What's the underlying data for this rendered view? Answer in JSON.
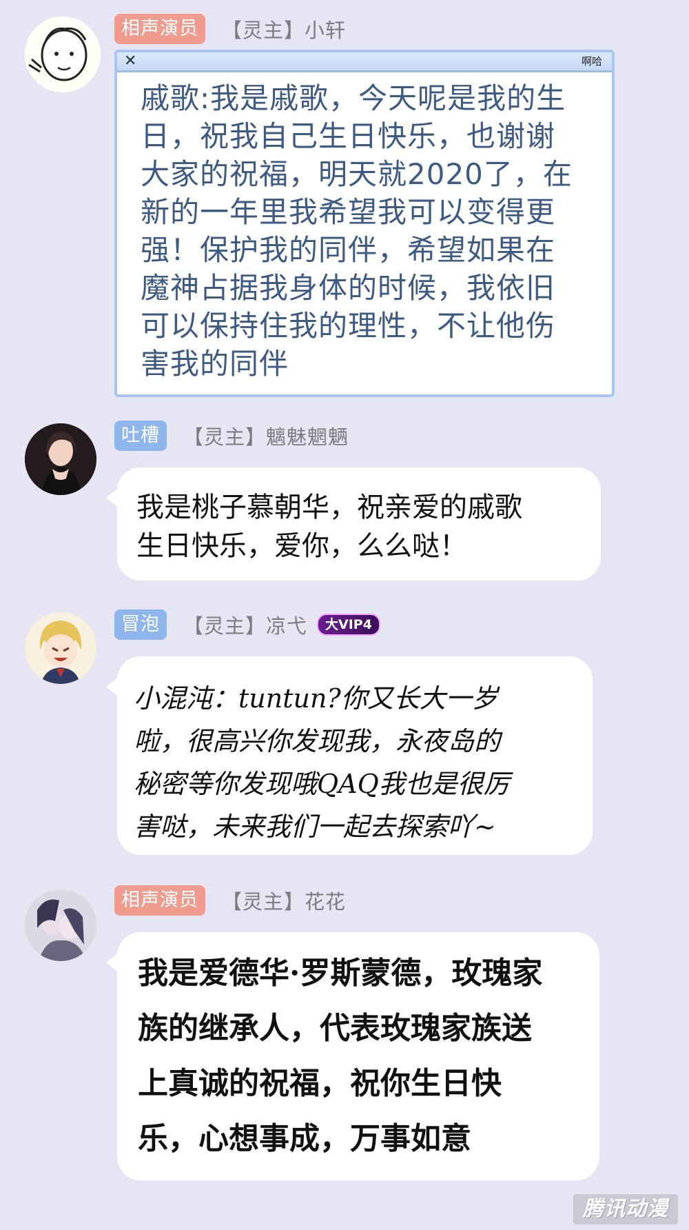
{
  "messages": [
    {
      "tag": "相声演员",
      "user": "【灵主】小轩",
      "window_label": "啊哈",
      "window_close": "✕",
      "text": "戚歌:我是戚歌，今天呢是我的生\n日，祝我自己生日快乐，也谢谢\n大家的祝福，明天就2020了，在\n新的一年里我希望我可以变得更\n强！保护我的同伴，希望如果在\n魔神占据我身体的时候，我依旧\n可以保持住我的理性，不让他伤\n害我的同伴"
    },
    {
      "tag": "吐槽",
      "user": "【灵主】魑魅魍魉",
      "text": "我是桃子慕朝华，祝亲爱的戚歌\n生日快乐，爱你，么么哒！"
    },
    {
      "tag": "冒泡",
      "user": "【灵主】凉弋",
      "badge": "大VIP4",
      "text": "小混沌：tuntun?你又长大一岁\n啦，很高兴你发现我，永夜岛的\n秘密等你发现哦QAQ我也是很厉\n害哒，未来我们一起去探索吖~"
    },
    {
      "tag": "相声演员",
      "user": "【灵主】花花",
      "text": "我是爱德华·罗斯蒙德，玫瑰家\n族的继承人，代表玫瑰家族送\n上真诚的祝福，祝你生日快\n乐，心想事成，万事如意"
    }
  ],
  "watermark": "腾讯动漫",
  "colors": {
    "background": "#e6e5f4",
    "tag_red": "#ef9b8e",
    "tag_blue": "#8fb6ec",
    "window_text": "#3d5a82",
    "window_border": "#a9c4ef"
  }
}
